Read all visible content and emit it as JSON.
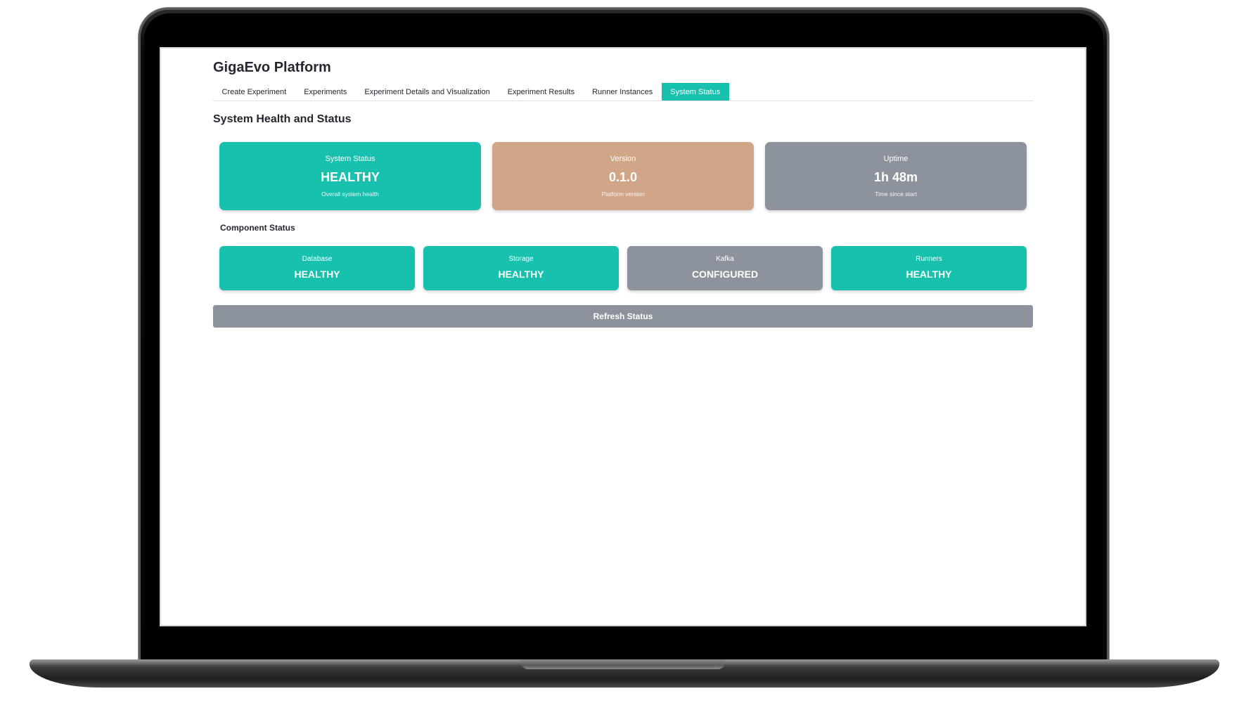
{
  "app": {
    "title": "GigaEvo Platform"
  },
  "tabs": [
    {
      "label": "Create Experiment",
      "active": false
    },
    {
      "label": "Experiments",
      "active": false
    },
    {
      "label": "Experiment Details and Visualization",
      "active": false
    },
    {
      "label": "Experiment Results",
      "active": false
    },
    {
      "label": "Runner Instances",
      "active": false
    },
    {
      "label": "System Status",
      "active": true
    }
  ],
  "main": {
    "title": "System Health and Status",
    "metrics": [
      {
        "label": "System Status",
        "value": "HEALTHY",
        "description": "Overall system health",
        "color": "#17c1ae"
      },
      {
        "label": "Version",
        "value": "0.1.0",
        "description": "Platform version",
        "color": "#d1a588"
      },
      {
        "label": "Uptime",
        "value": "1h 48m",
        "description": "Time since start",
        "color": "#8d939c"
      }
    ],
    "component_title": "Component Status",
    "components": [
      {
        "label": "Database",
        "value": "HEALTHY",
        "color": "#17c1ae"
      },
      {
        "label": "Storage",
        "value": "HEALTHY",
        "color": "#17c1ae"
      },
      {
        "label": "Kafka",
        "value": "CONFIGURED",
        "color": "#8d939c"
      },
      {
        "label": "Runners",
        "value": "HEALTHY",
        "color": "#17c1ae"
      }
    ],
    "refresh_label": "Refresh Status"
  }
}
